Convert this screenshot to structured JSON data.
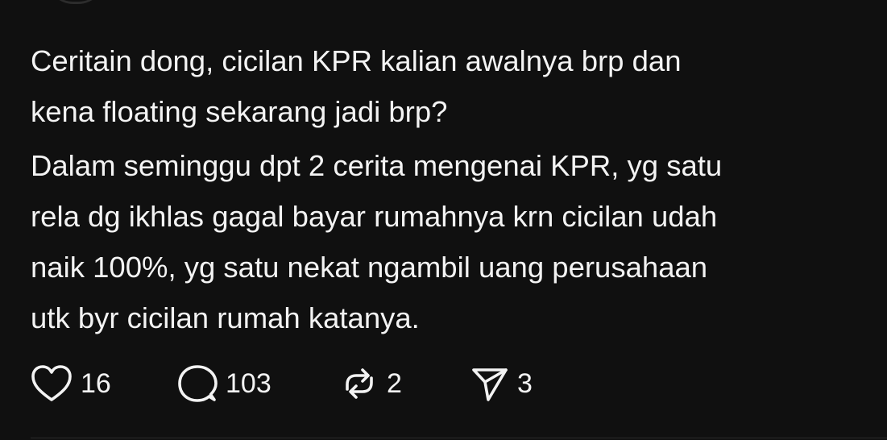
{
  "post": {
    "paragraphs": [
      [
        "Ceritain dong, cicilan KPR kalian awalnya brp dan",
        "kena floating sekarang jadi brp?"
      ],
      [
        "Dalam seminggu dpt 2 cerita mengenai KPR, yg satu",
        "rela dg ikhlas gagal bayar rumahnya krn cicilan udah",
        "naik 100%, yg satu nekat ngambil uang perusahaan",
        "utk byr cicilan rumah katanya."
      ]
    ]
  },
  "actions": {
    "likes": "16",
    "replies": "103",
    "reposts": "2",
    "shares": "3"
  },
  "icons": {
    "like": "heart-icon",
    "reply": "comment-bubble-icon",
    "repost": "repost-arrows-icon",
    "share": "send-paper-plane-icon"
  },
  "colors": {
    "background": "#101010",
    "text": "#f3f3f3"
  }
}
